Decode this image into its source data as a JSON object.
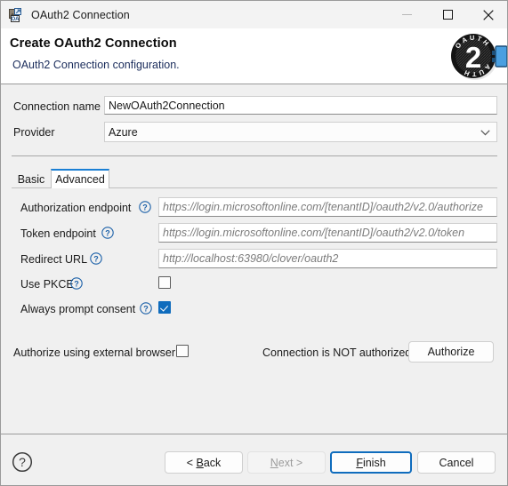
{
  "window": {
    "title": "OAuth2 Connection",
    "icon": "oauth2-wizard-icon",
    "controls": {
      "minimize": "minimize-icon",
      "maximize": "maximize-icon",
      "close": "close-icon"
    }
  },
  "header": {
    "title": "Create OAuth2 Connection",
    "subtitle": "OAuth2 Connection configuration.",
    "logo_text_top": "OAUTH",
    "logo_text_bottom": "AUTH",
    "logo_digit": "2"
  },
  "form": {
    "connection_name": {
      "label": "Connection name",
      "value": "NewOAuth2Connection"
    },
    "provider": {
      "label": "Provider",
      "value": "Azure",
      "options": [
        "Azure"
      ]
    }
  },
  "tabs": {
    "items": [
      {
        "label": "Basic",
        "active": false
      },
      {
        "label": "Advanced",
        "active": true
      }
    ]
  },
  "advanced": {
    "authorization_endpoint": {
      "label": "Authorization endpoint",
      "value": "",
      "placeholder": "https://login.microsoftonline.com/[tenantID]/oauth2/v2.0/authorize",
      "help": "help-icon"
    },
    "token_endpoint": {
      "label": "Token endpoint",
      "value": "",
      "placeholder": "https://login.microsoftonline.com/[tenantID]/oauth2/v2.0/token",
      "help": "help-icon"
    },
    "redirect_url": {
      "label": "Redirect URL",
      "value": "",
      "placeholder": "http://localhost:63980/clover/oauth2",
      "help": "help-icon"
    },
    "use_pkce": {
      "label": "Use PKCE",
      "checked": false,
      "help": "help-icon"
    },
    "always_prompt_consent": {
      "label": "Always prompt consent",
      "checked": true,
      "help": "help-icon"
    }
  },
  "authorization": {
    "external_browser_label": "Authorize using external browser",
    "external_browser_checked": false,
    "status_text": "Connection is NOT authorized",
    "authorize_button": "Authorize"
  },
  "footer": {
    "help_icon": "help-icon",
    "back_button": {
      "prefix": "< ",
      "mnemonic": "B",
      "suffix": "ack"
    },
    "next_button": {
      "mnemonic": "N",
      "suffix": "ext >"
    },
    "finish_button": {
      "mnemonic": "F",
      "suffix": "inish"
    },
    "cancel_button": "Cancel"
  },
  "colors": {
    "accent": "#0f6cbd",
    "tab_active_top": "#1a7fd4",
    "header_subtitle": "#1b2d5c",
    "placeholder": "#7c7c7c",
    "body_bg": "#f0f0f0"
  }
}
